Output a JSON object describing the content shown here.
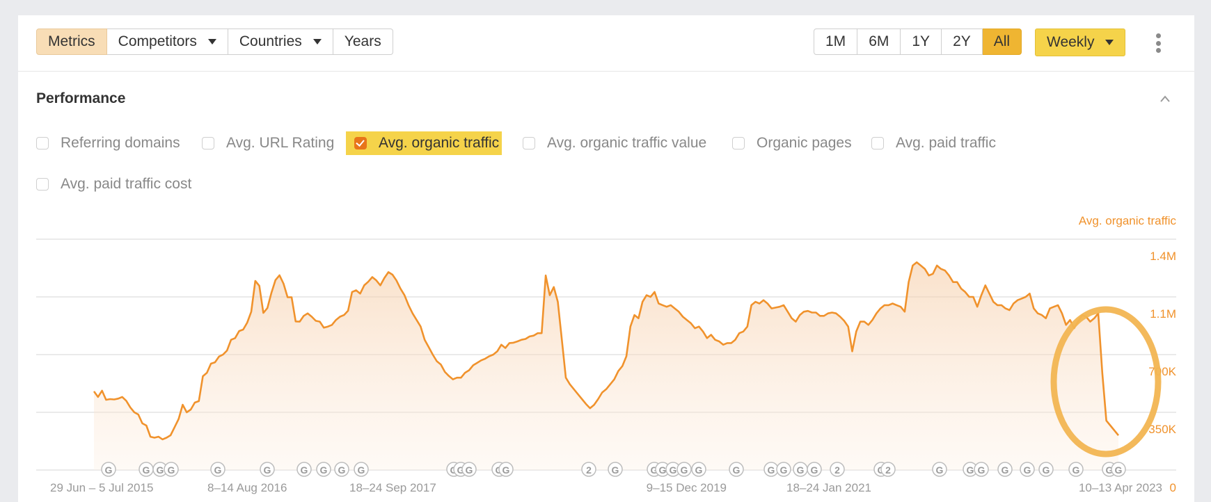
{
  "toolbar": {
    "left_buttons": [
      {
        "label": "Metrics",
        "active": true
      },
      {
        "label": "Competitors",
        "dropdown": true
      },
      {
        "label": "Countries",
        "dropdown": true
      },
      {
        "label": "Years"
      }
    ],
    "range_buttons": [
      {
        "label": "1M"
      },
      {
        "label": "6M"
      },
      {
        "label": "1Y"
      },
      {
        "label": "2Y"
      },
      {
        "label": "All",
        "active": true
      }
    ],
    "interval_select": "Weekly",
    "more_icon": "kebab-vertical-icon"
  },
  "section": {
    "title": "Performance",
    "collapse_icon": "chevron-up-icon"
  },
  "metrics": [
    {
      "label": "Referring domains",
      "checked": false
    },
    {
      "label": "Avg. URL Rating",
      "checked": false
    },
    {
      "label": "Avg. organic traffic",
      "checked": true
    },
    {
      "label": "Avg. organic traffic value",
      "checked": false
    },
    {
      "label": "Organic pages",
      "checked": false
    },
    {
      "label": "Avg. paid traffic",
      "checked": false
    },
    {
      "label": "Avg. paid traffic cost",
      "checked": false
    }
  ],
  "colors": {
    "series": "#f0922c",
    "highlight_circle": "#f2b552",
    "checked_metric_bg": "#f5d34a",
    "active_range": "#efb532"
  },
  "chart_data": {
    "type": "area",
    "title": "",
    "series_label": "Avg. organic traffic",
    "ylim": [
      0,
      1400000
    ],
    "y_ticks": [
      {
        "value": 1400000,
        "label": "1.4M"
      },
      {
        "value": 1050000,
        "label": "1.1M"
      },
      {
        "value": 700000,
        "label": "700K"
      },
      {
        "value": 350000,
        "label": "350K"
      },
      {
        "value": 0,
        "label": "0"
      }
    ],
    "x_tick_labels": [
      "29 Jun – 5 Jul 2015",
      "8–14 Aug 2016",
      "18–24 Sep 2017",
      "9–15 Dec 2019",
      "18–24 Jan 2021",
      "10–13 Apr 2023"
    ],
    "x_range": [
      "2015-06-29",
      "2023-04-13"
    ],
    "grid": true,
    "annotation": "circle highlighting sharp drop at end (Apr 2023)",
    "series": [
      {
        "name": "Avg. organic traffic",
        "values": [
          477000,
          443000,
          481000,
          426000,
          430000,
          428000,
          433000,
          443000,
          420000,
          380000,
          350000,
          337000,
          283000,
          270000,
          202000,
          196000,
          202000,
          186000,
          196000,
          211000,
          260000,
          310000,
          396000,
          350000,
          367000,
          409000,
          418000,
          569000,
          590000,
          645000,
          653000,
          688000,
          700000,
          725000,
          790000,
          800000,
          843000,
          852000,
          894000,
          960000,
          1147000,
          1117000,
          953000,
          982000,
          1075000,
          1152000,
          1181000,
          1130000,
          1048000,
          1048000,
          901000,
          900000,
          935000,
          950000,
          930000,
          905000,
          900000,
          863000,
          870000,
          880000,
          910000,
          930000,
          940000,
          966000,
          1080000,
          1090000,
          1070000,
          1120000,
          1142000,
          1170000,
          1150000,
          1120000,
          1165000,
          1200000,
          1185000,
          1150000,
          1100000,
          1060000,
          1000000,
          950000,
          910000,
          870000,
          790000,
          745000,
          700000,
          660000,
          640000,
          595000,
          570000,
          550000,
          560000,
          560000,
          590000,
          605000,
          635000,
          650000,
          665000,
          675000,
          690000,
          700000,
          720000,
          760000,
          740000,
          770000,
          772000,
          780000,
          790000,
          795000,
          810000,
          815000,
          830000,
          830000,
          1180000,
          1060000,
          1110000,
          1020000,
          790000,
          560000,
          520000,
          490000,
          460000,
          430000,
          400000,
          375000,
          395000,
          430000,
          470000,
          490000,
          520000,
          550000,
          600000,
          630000,
          690000,
          870000,
          940000,
          920000,
          1020000,
          1060000,
          1050000,
          1080000,
          1010000,
          1000000,
          990000,
          1000000,
          980000,
          960000,
          930000,
          910000,
          890000,
          860000,
          870000,
          840000,
          800000,
          820000,
          790000,
          780000,
          760000,
          770000,
          770000,
          790000,
          830000,
          840000,
          870000,
          1000000,
          1020000,
          1010000,
          1030000,
          1010000,
          980000,
          985000,
          990000,
          1000000,
          960000,
          920000,
          900000,
          940000,
          960000,
          965000,
          955000,
          955000,
          935000,
          935000,
          950000,
          955000,
          950000,
          930000,
          905000,
          870000,
          720000,
          840000,
          900000,
          900000,
          880000,
          910000,
          950000,
          980000,
          1000000,
          1000000,
          1010000,
          1000000,
          990000,
          960000,
          1140000,
          1240000,
          1260000,
          1240000,
          1220000,
          1180000,
          1190000,
          1240000,
          1220000,
          1210000,
          1180000,
          1140000,
          1140000,
          1100000,
          1080000,
          1050000,
          1050000,
          990000,
          1060000,
          1120000,
          1070000,
          1020000,
          1000000,
          1000000,
          980000,
          970000,
          1010000,
          1030000,
          1040000,
          1050000,
          1070000,
          980000,
          950000,
          940000,
          920000,
          980000,
          990000,
          1000000,
          950000,
          880000,
          910000,
          860000,
          900000,
          940000,
          930000,
          900000,
          920000,
          950000,
          590000,
          300000,
          270000,
          240000,
          210000
        ]
      }
    ]
  },
  "event_markers": [
    "G",
    "G",
    "G",
    "G",
    "G",
    "G",
    "G",
    "G",
    "G",
    "G",
    "G",
    "G",
    "G",
    "G",
    "G",
    "2",
    "G",
    "G",
    "G",
    "G",
    "G",
    "G",
    "G",
    "G",
    "G",
    "G",
    "G",
    "2",
    "G",
    "2",
    "G",
    "G",
    "G",
    "G",
    "G",
    "G",
    "G",
    "G",
    "G"
  ]
}
